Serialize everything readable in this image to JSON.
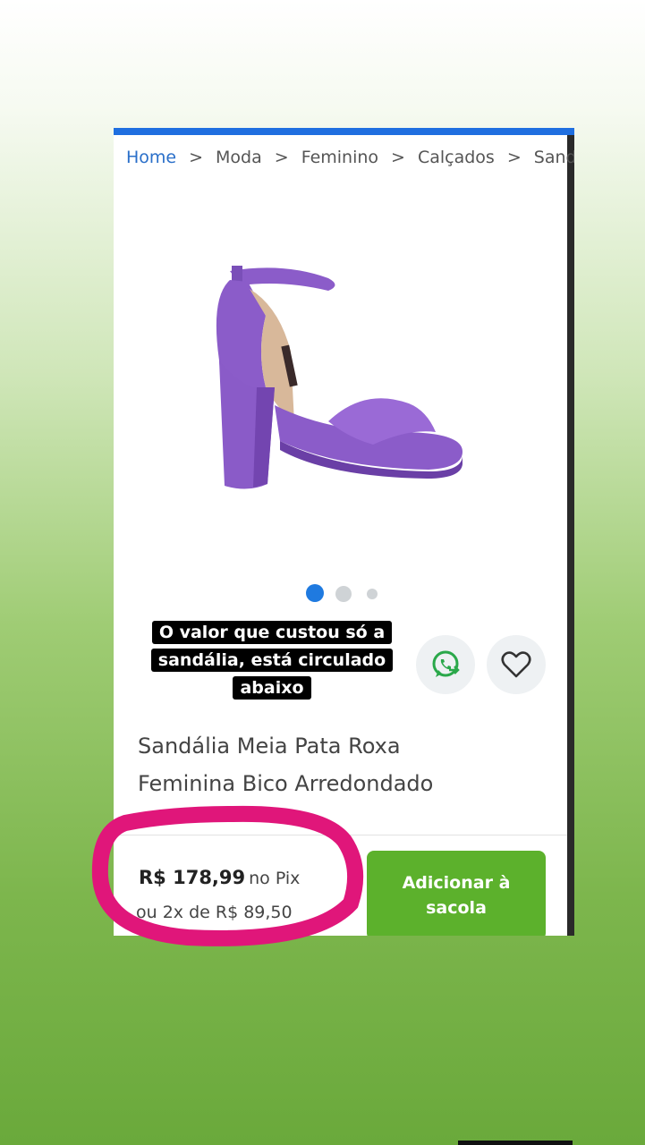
{
  "breadcrumb": {
    "home": "Home",
    "items": [
      "Moda",
      "Feminino",
      "Calçados",
      "Sandá"
    ],
    "separator": ">"
  },
  "product": {
    "title_line1": "Sandália Meia Pata Roxa",
    "title_line2": "Feminina Bico Arredondado",
    "price": "R$ 178,99",
    "price_suffix": "no Pix",
    "installments": "ou 2x de R$ 89,50",
    "add_button_line1": "Adicionar à",
    "add_button_line2": "sacola",
    "image_dots_count": 3,
    "active_image_index": 0
  },
  "story_caption": {
    "line1": "O valor que custou só a",
    "line2": "sandália, está circulado",
    "line3": "abaixo"
  },
  "icons": [
    "whatsapp-icon",
    "heart-icon"
  ],
  "colors": {
    "link": "#2a6fc9",
    "accent_blue": "#1f6fe0",
    "add_button": "#5cb12c",
    "highlight_circle": "#e0167a",
    "shoe": "#8b5cc9"
  }
}
